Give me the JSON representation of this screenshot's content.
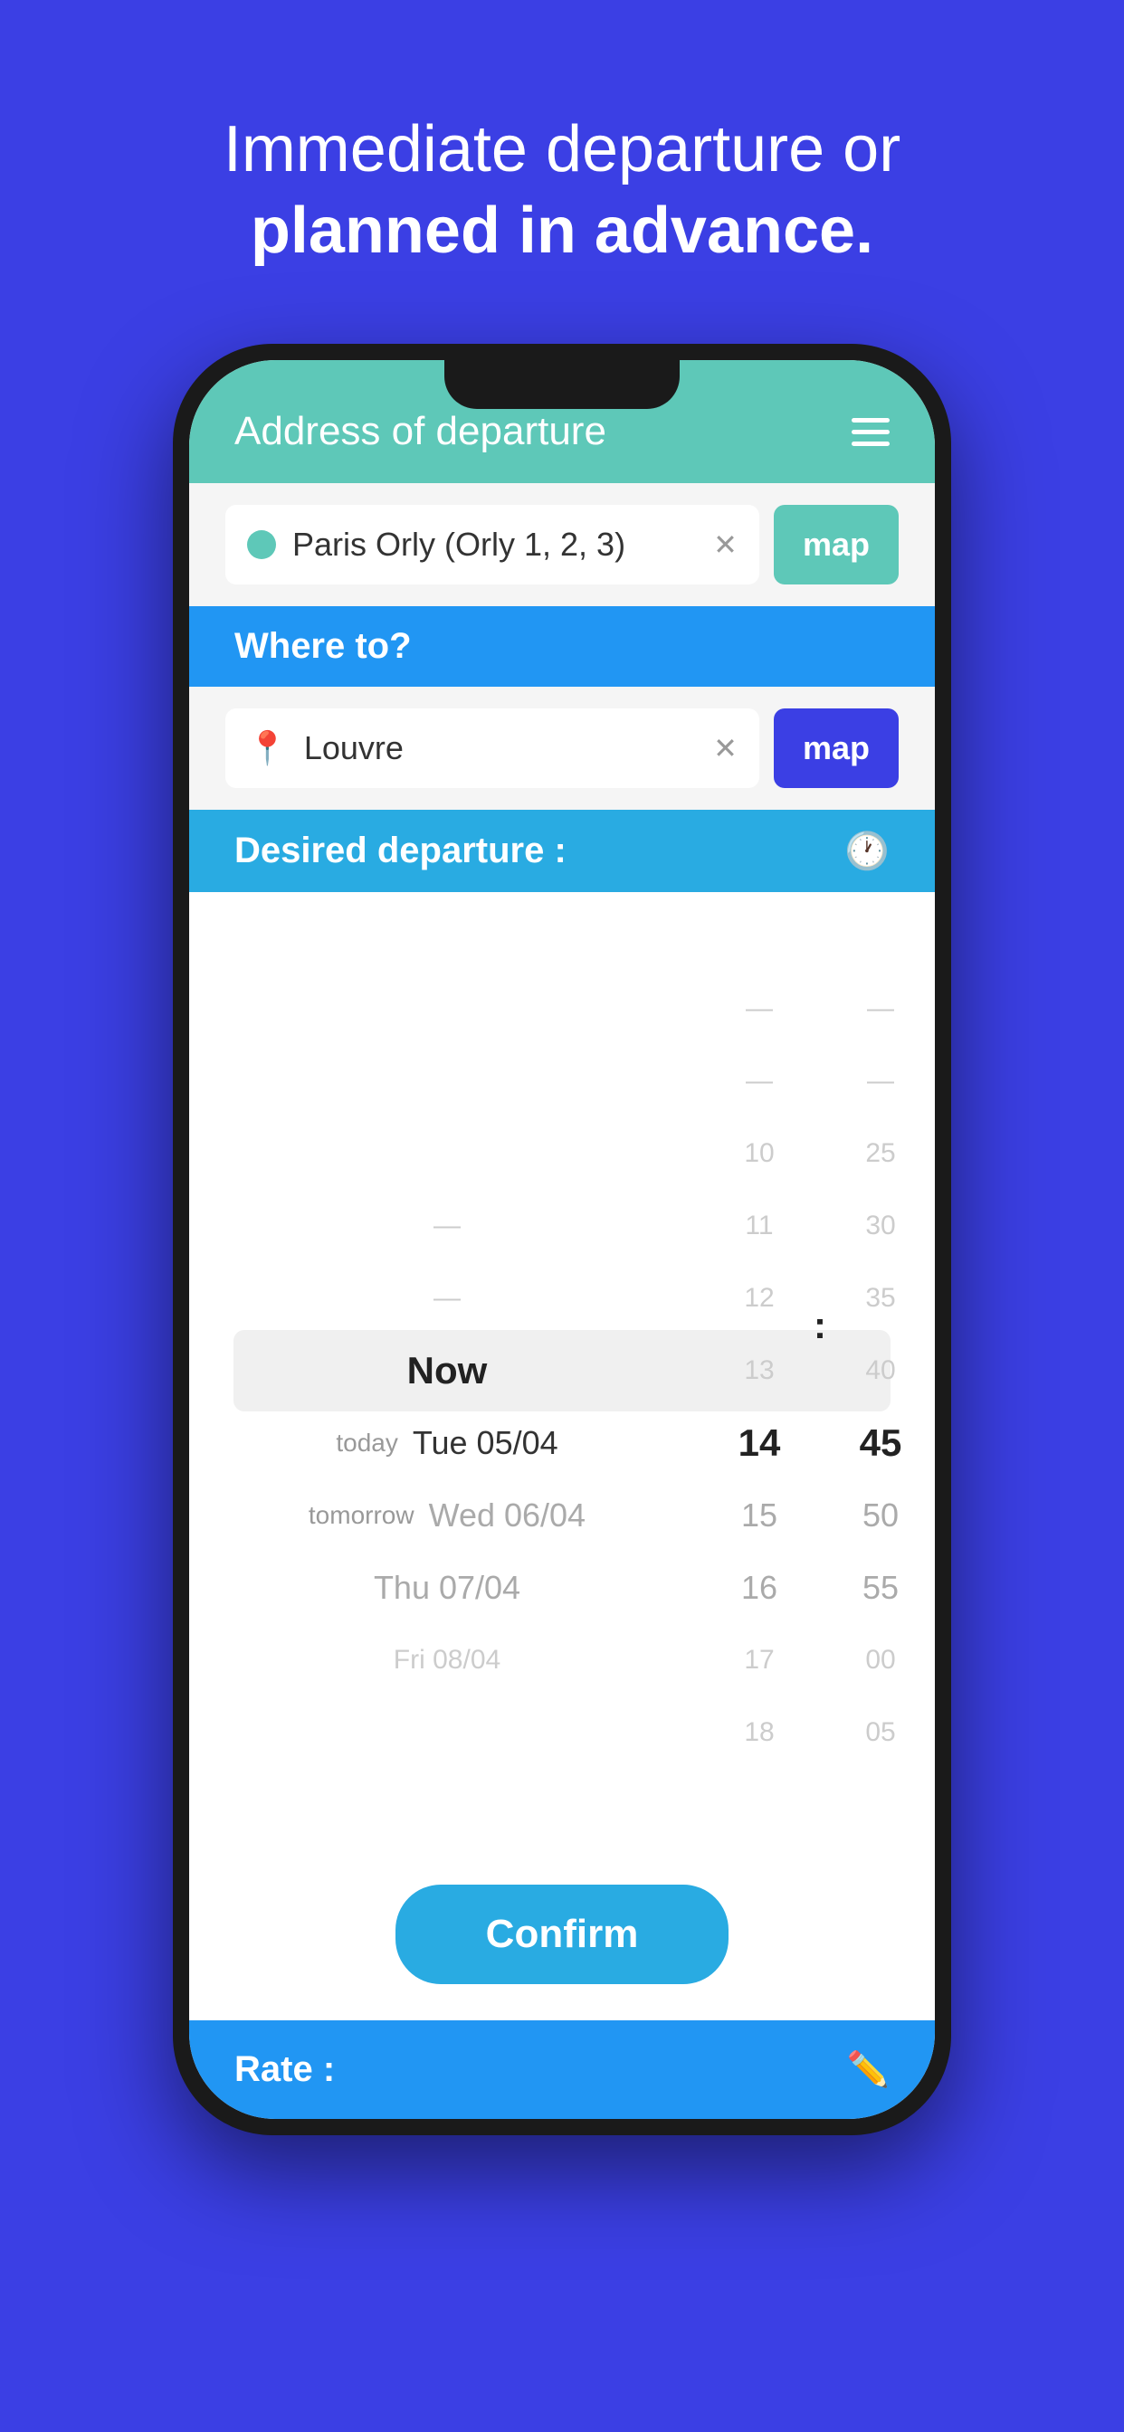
{
  "headline": {
    "line1": "Immediate departure or",
    "line2": "planned in advance."
  },
  "phone": {
    "header": {
      "title": "Address of departure",
      "menu_label": "menu"
    },
    "departure_input": {
      "value": "Paris Orly (Orly 1, 2, 3)",
      "button_label": "map"
    },
    "where_to": {
      "label": "Where to?"
    },
    "destination_input": {
      "value": "Louvre",
      "button_label": "map"
    },
    "desired_departure": {
      "label": "Desired departure :"
    },
    "time_picker": {
      "dates": [
        {
          "prefix": "",
          "value": "Now",
          "state": "selected"
        },
        {
          "prefix": "today",
          "value": "Tue 05/04",
          "state": "normal"
        },
        {
          "prefix": "tomorrow",
          "value": "Wed 06/04",
          "state": "normal"
        },
        {
          "prefix": "",
          "value": "Thu 07/04",
          "state": "normal"
        },
        {
          "prefix": "",
          "value": "Fri 08/04",
          "state": "faded"
        }
      ],
      "hours": [
        "10",
        "11",
        "12",
        "13",
        "14",
        "15",
        "16",
        "17",
        "18"
      ],
      "minutes": [
        "25",
        "30",
        "35",
        "40",
        "45",
        "50",
        "55",
        "00",
        "05"
      ],
      "selected_hour": "14",
      "selected_minute": "45"
    },
    "confirm_button": {
      "label": "Confirm"
    },
    "rate_bar": {
      "label": "Rate :"
    }
  }
}
